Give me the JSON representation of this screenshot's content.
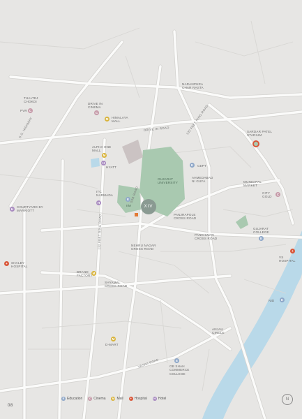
{
  "page_number": "08",
  "north": "N",
  "logo_text": "XIV",
  "colors": {
    "background": "#e7e6e4",
    "road": "#fbfbfa",
    "road_outline": "#d6d5d2",
    "river": "#b9d9e9",
    "green": "#a9c9b0",
    "education": "#8fa8c9",
    "cinema": "#c69ba9",
    "mall": "#d9b43c",
    "hospital": "#d9583b",
    "hotel": "#a98bc0"
  },
  "roads": {
    "drive_in": "DRIVE IN ROAD",
    "ring_top": "132 FEET RING ROAD",
    "ring_left": "132 FEET RING ROAD",
    "sg_highway": "S.G. HIGHWAY",
    "ssb": "SSB ROAD",
    "vasna": "VASNA ROAD"
  },
  "places": {
    "naranpura": "NARANPURA\nCHAR RASTA",
    "thaltej": "THALTEJ\nCHOKDI",
    "pvr": "PVR",
    "drive_in_cinema": "DRIVE IN\nCINEMA",
    "himalaya_mall": "HIMALAYA\nMALL",
    "sardar_patel": "SARDAR PATEL\nSTADIUM",
    "alpha_one": "ALPHA ONE\nMALL",
    "hyatt": "HYATT",
    "cept": "CEPT",
    "gujarat_university": "GUJARAT\nUNIVERSITY",
    "ahmedabad_ni_gufa": "AHMEDABAD\nNI GUFA",
    "municipal_market": "MUNICIPAL\nMARKET",
    "city_gold": "CITY\nGOLD",
    "itc_narmada": "ITC\nNARMADA",
    "iim": "IIM",
    "courtyard": "COURTYARD BY\nMARRIOTT",
    "panjrapole": "PANJRAPOLE\nCROSS ROAD",
    "panchwati": "PANCHWATI\nCROSS ROAD",
    "gujarat_college": "GUJARAT\nCOLLEGE",
    "nehru_nagar": "NEHRU NAGAR\nCROSS ROAD",
    "vs_hospital": "VS\nHOSPITAL",
    "shalby": "SHALBY\nHOSPITAL",
    "brand_factory": "BRAND\nFACTORY",
    "shyamal": "SHYAMAL\nCROSS ROAD",
    "nid": "NID",
    "anjali": "ANJALI\nCIRCLE",
    "dmart": "D-MART",
    "gb_shah": "GB SHAH\nCOMMERCE\nCOLLEGE"
  },
  "legend": [
    {
      "label": "Education",
      "icon": "education-icon",
      "glyph": "E",
      "type": "edu"
    },
    {
      "label": "Cinema",
      "icon": "cinema-icon",
      "glyph": "C",
      "type": "cin"
    },
    {
      "label": "Mall",
      "icon": "mall-icon",
      "glyph": "M",
      "type": "mall"
    },
    {
      "label": "Hospital",
      "icon": "hospital-icon",
      "glyph": "+",
      "type": "hosp"
    },
    {
      "label": "Hotel",
      "icon": "hotel-icon",
      "glyph": "H",
      "type": "hotel"
    }
  ],
  "marker_glyphs": {
    "edu": "E",
    "cin": "C",
    "mall": "M",
    "hosp": "+",
    "hotel": "H"
  }
}
